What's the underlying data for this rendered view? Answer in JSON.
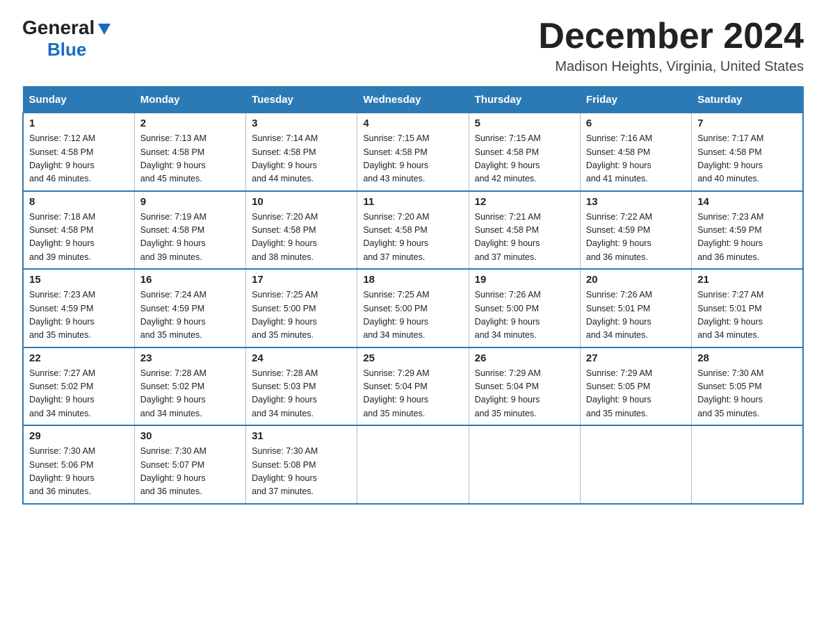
{
  "logo": {
    "general": "General",
    "blue": "Blue"
  },
  "title": "December 2024",
  "location": "Madison Heights, Virginia, United States",
  "weekdays": [
    "Sunday",
    "Monday",
    "Tuesday",
    "Wednesday",
    "Thursday",
    "Friday",
    "Saturday"
  ],
  "weeks": [
    [
      {
        "day": "1",
        "sunrise": "7:12 AM",
        "sunset": "4:58 PM",
        "daylight": "9 hours and 46 minutes."
      },
      {
        "day": "2",
        "sunrise": "7:13 AM",
        "sunset": "4:58 PM",
        "daylight": "9 hours and 45 minutes."
      },
      {
        "day": "3",
        "sunrise": "7:14 AM",
        "sunset": "4:58 PM",
        "daylight": "9 hours and 44 minutes."
      },
      {
        "day": "4",
        "sunrise": "7:15 AM",
        "sunset": "4:58 PM",
        "daylight": "9 hours and 43 minutes."
      },
      {
        "day": "5",
        "sunrise": "7:15 AM",
        "sunset": "4:58 PM",
        "daylight": "9 hours and 42 minutes."
      },
      {
        "day": "6",
        "sunrise": "7:16 AM",
        "sunset": "4:58 PM",
        "daylight": "9 hours and 41 minutes."
      },
      {
        "day": "7",
        "sunrise": "7:17 AM",
        "sunset": "4:58 PM",
        "daylight": "9 hours and 40 minutes."
      }
    ],
    [
      {
        "day": "8",
        "sunrise": "7:18 AM",
        "sunset": "4:58 PM",
        "daylight": "9 hours and 39 minutes."
      },
      {
        "day": "9",
        "sunrise": "7:19 AM",
        "sunset": "4:58 PM",
        "daylight": "9 hours and 39 minutes."
      },
      {
        "day": "10",
        "sunrise": "7:20 AM",
        "sunset": "4:58 PM",
        "daylight": "9 hours and 38 minutes."
      },
      {
        "day": "11",
        "sunrise": "7:20 AM",
        "sunset": "4:58 PM",
        "daylight": "9 hours and 37 minutes."
      },
      {
        "day": "12",
        "sunrise": "7:21 AM",
        "sunset": "4:58 PM",
        "daylight": "9 hours and 37 minutes."
      },
      {
        "day": "13",
        "sunrise": "7:22 AM",
        "sunset": "4:59 PM",
        "daylight": "9 hours and 36 minutes."
      },
      {
        "day": "14",
        "sunrise": "7:23 AM",
        "sunset": "4:59 PM",
        "daylight": "9 hours and 36 minutes."
      }
    ],
    [
      {
        "day": "15",
        "sunrise": "7:23 AM",
        "sunset": "4:59 PM",
        "daylight": "9 hours and 35 minutes."
      },
      {
        "day": "16",
        "sunrise": "7:24 AM",
        "sunset": "4:59 PM",
        "daylight": "9 hours and 35 minutes."
      },
      {
        "day": "17",
        "sunrise": "7:25 AM",
        "sunset": "5:00 PM",
        "daylight": "9 hours and 35 minutes."
      },
      {
        "day": "18",
        "sunrise": "7:25 AM",
        "sunset": "5:00 PM",
        "daylight": "9 hours and 34 minutes."
      },
      {
        "day": "19",
        "sunrise": "7:26 AM",
        "sunset": "5:00 PM",
        "daylight": "9 hours and 34 minutes."
      },
      {
        "day": "20",
        "sunrise": "7:26 AM",
        "sunset": "5:01 PM",
        "daylight": "9 hours and 34 minutes."
      },
      {
        "day": "21",
        "sunrise": "7:27 AM",
        "sunset": "5:01 PM",
        "daylight": "9 hours and 34 minutes."
      }
    ],
    [
      {
        "day": "22",
        "sunrise": "7:27 AM",
        "sunset": "5:02 PM",
        "daylight": "9 hours and 34 minutes."
      },
      {
        "day": "23",
        "sunrise": "7:28 AM",
        "sunset": "5:02 PM",
        "daylight": "9 hours and 34 minutes."
      },
      {
        "day": "24",
        "sunrise": "7:28 AM",
        "sunset": "5:03 PM",
        "daylight": "9 hours and 34 minutes."
      },
      {
        "day": "25",
        "sunrise": "7:29 AM",
        "sunset": "5:04 PM",
        "daylight": "9 hours and 35 minutes."
      },
      {
        "day": "26",
        "sunrise": "7:29 AM",
        "sunset": "5:04 PM",
        "daylight": "9 hours and 35 minutes."
      },
      {
        "day": "27",
        "sunrise": "7:29 AM",
        "sunset": "5:05 PM",
        "daylight": "9 hours and 35 minutes."
      },
      {
        "day": "28",
        "sunrise": "7:30 AM",
        "sunset": "5:05 PM",
        "daylight": "9 hours and 35 minutes."
      }
    ],
    [
      {
        "day": "29",
        "sunrise": "7:30 AM",
        "sunset": "5:06 PM",
        "daylight": "9 hours and 36 minutes."
      },
      {
        "day": "30",
        "sunrise": "7:30 AM",
        "sunset": "5:07 PM",
        "daylight": "9 hours and 36 minutes."
      },
      {
        "day": "31",
        "sunrise": "7:30 AM",
        "sunset": "5:08 PM",
        "daylight": "9 hours and 37 minutes."
      },
      null,
      null,
      null,
      null
    ]
  ],
  "labels": {
    "sunrise_prefix": "Sunrise: ",
    "sunset_prefix": "Sunset: ",
    "daylight_prefix": "Daylight: "
  }
}
